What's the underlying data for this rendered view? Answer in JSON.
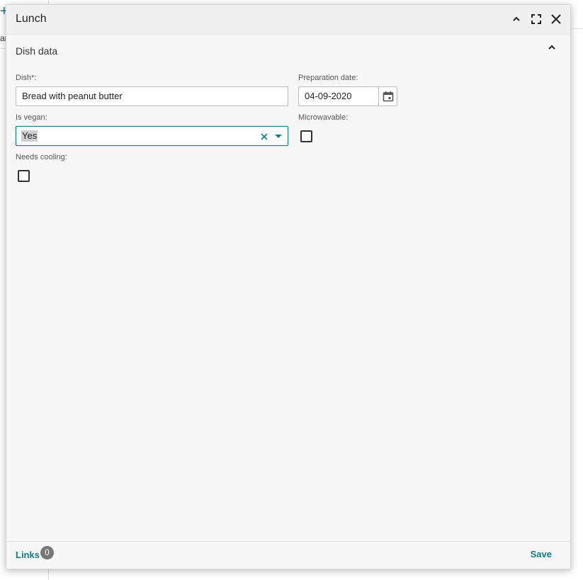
{
  "background": {
    "glyph_top": "+",
    "glyph_side": "ar"
  },
  "dialog": {
    "title": "Lunch",
    "controls": {
      "collapse_icon": "chevron-up-icon",
      "maximize_icon": "maximize-icon",
      "close_icon": "close-icon"
    }
  },
  "section": {
    "title": "Dish data",
    "toggle_icon": "chevron-up-icon"
  },
  "form": {
    "dish": {
      "label": "Dish*:",
      "value": "Bread with peanut butter"
    },
    "preparation_date": {
      "label": "Preparation date:",
      "value": "04-09-2020",
      "icon": "calendar-icon"
    },
    "is_vegan": {
      "label": "Is vegan:",
      "value": "Yes",
      "clear_icon": "clear-icon",
      "dropdown_icon": "dropdown-caret-icon"
    },
    "microwavable": {
      "label": "Microwavable:",
      "checked": false
    },
    "needs_cooling": {
      "label": "Needs cooling:",
      "checked": false
    }
  },
  "footer": {
    "links_label": "Links",
    "links_count": "0",
    "save_label": "Save"
  },
  "colors": {
    "accent": "#0f7c80",
    "badge": "#777777",
    "dialog_bg": "#f7f7f7"
  }
}
